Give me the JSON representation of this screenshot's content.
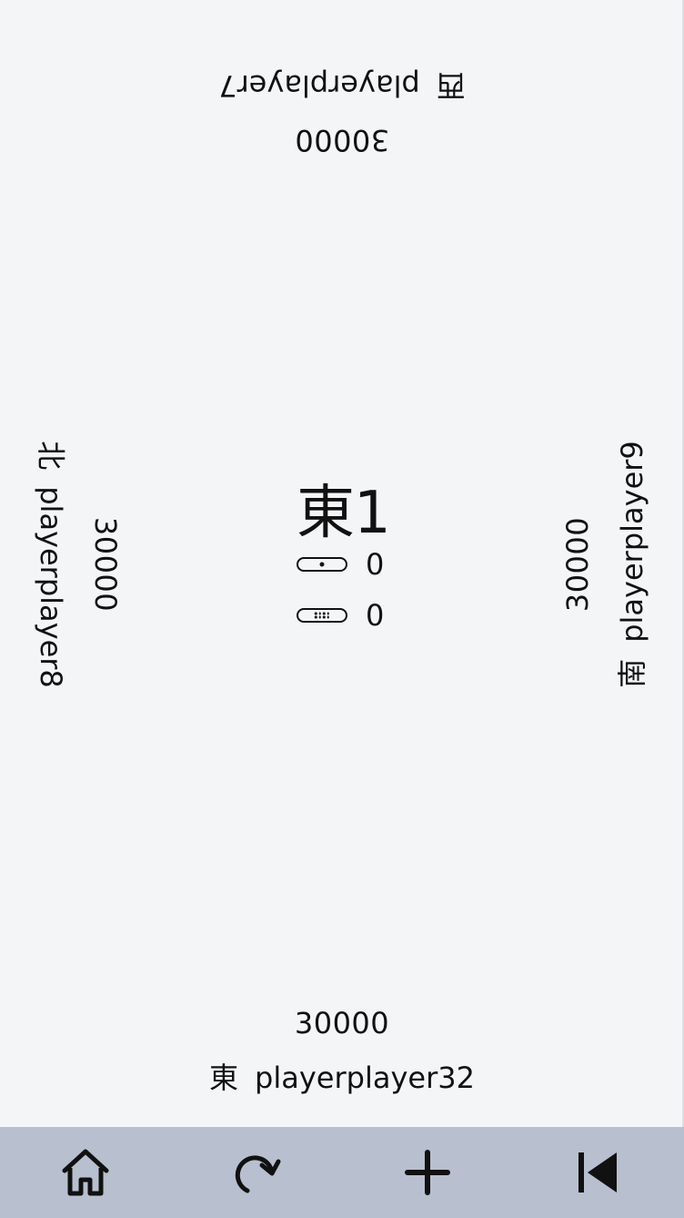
{
  "round": {
    "label": "東1"
  },
  "sticks": {
    "honba_count": "0",
    "riichi_count": "0"
  },
  "players": {
    "bottom": {
      "wind": "東",
      "name": "playerplayer32",
      "score": "30000"
    },
    "right": {
      "wind": "南",
      "name": "playerplayer9",
      "score": "30000"
    },
    "top": {
      "wind": "西",
      "name": "playerplayer7",
      "score": "30000"
    },
    "left": {
      "wind": "北",
      "name": "playerplayer8",
      "score": "30000"
    }
  },
  "toolbar": {
    "buttons": [
      {
        "icon": "home-icon"
      },
      {
        "icon": "redo-icon"
      },
      {
        "icon": "plus-icon"
      },
      {
        "icon": "skip-back-icon"
      }
    ]
  },
  "colors": {
    "background": "#f4f5f7",
    "toolbar": "#b8bfcf",
    "text": "#111111"
  }
}
